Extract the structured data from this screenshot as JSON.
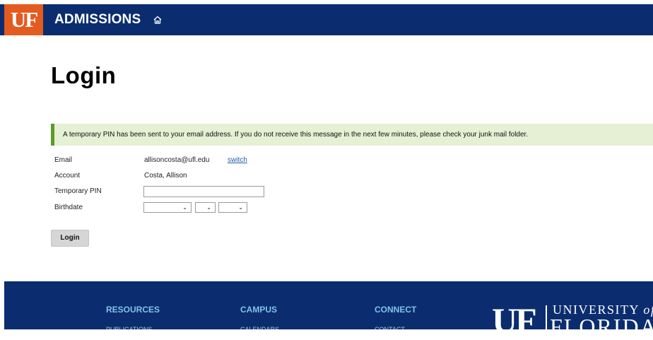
{
  "header": {
    "logo_text": "UF",
    "title": "ADMISSIONS",
    "home_icon": "home-icon",
    "colors": {
      "bar": "#0b2d6f",
      "logo_bg": "#e35b1f"
    }
  },
  "page": {
    "title": "Login"
  },
  "alert": {
    "message": "A temporary PIN has been sent to your email address. If you do not receive this message in the next few minutes, please check your junk mail folder.",
    "colors": {
      "bg": "#e5f0d4",
      "border": "#5b9a2b"
    }
  },
  "form": {
    "email_label": "Email",
    "email_value": "allisoncosta@ufl.edu",
    "switch_label": "switch",
    "account_label": "Account",
    "account_value": "Costa, Allison",
    "pin_label": "Temporary PIN",
    "pin_value": "",
    "birthdate_label": "Birthdate",
    "birthdate_month": "",
    "birthdate_day": "",
    "birthdate_year": "",
    "submit_label": "Login"
  },
  "footer": {
    "columns": [
      {
        "heading": "RESOURCES",
        "first_link": "PUBLICATIONS"
      },
      {
        "heading": "CAMPUS",
        "first_link": "CALENDARS"
      },
      {
        "heading": "CONNECT",
        "first_link": "CONTACT"
      }
    ],
    "logo": {
      "mark": "UF",
      "line1": "UNIVERSITY",
      "line1_suffix": "of",
      "line2": "FLORIDA"
    }
  }
}
